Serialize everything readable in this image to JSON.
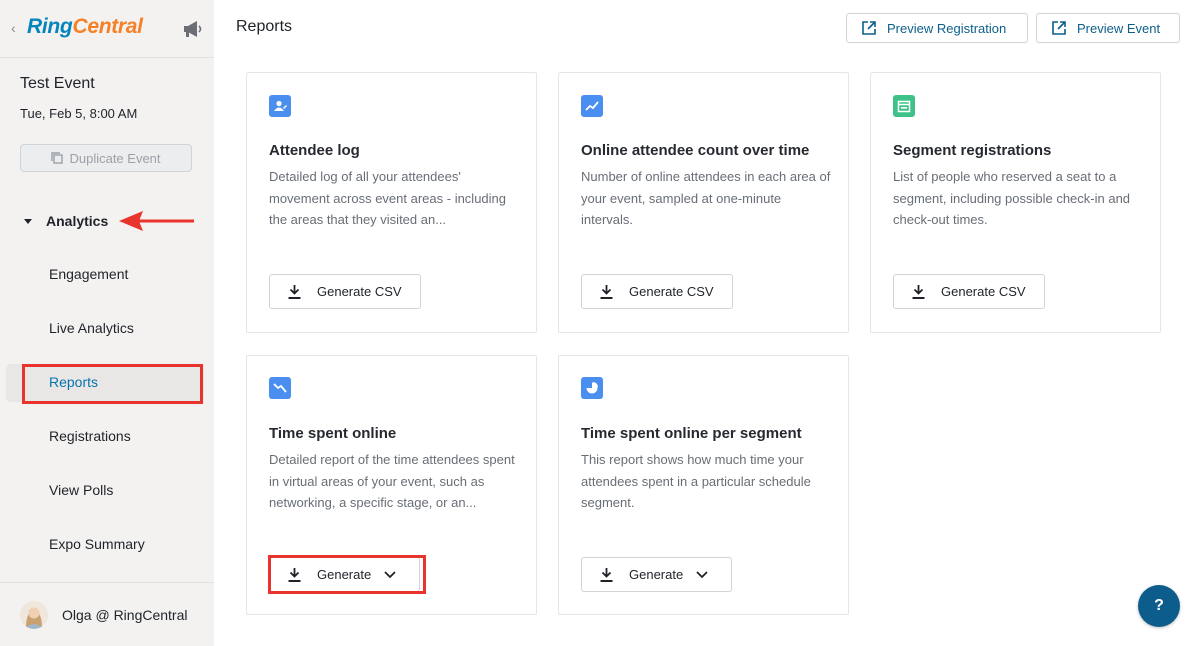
{
  "logo": {
    "ring": "Ring",
    "central": "Central"
  },
  "sidebar": {
    "event_title": "Test Event",
    "event_date": "Tue, Feb 5, 8:00 AM",
    "duplicate_label": "Duplicate Event",
    "section_label": "Analytics",
    "items": [
      {
        "label": "Engagement"
      },
      {
        "label": "Live Analytics"
      },
      {
        "label": "Reports",
        "active": true
      },
      {
        "label": "Registrations"
      },
      {
        "label": "View Polls"
      },
      {
        "label": "Expo Summary"
      }
    ],
    "user_name": "Olga @ RingCentral"
  },
  "header": {
    "title": "Reports",
    "preview_registration": "Preview Registration",
    "preview_event": "Preview Event"
  },
  "cards": [
    {
      "title": "Attendee log",
      "desc": "Detailed log of all your attendees' movement across event areas - including the areas that they visited an...",
      "button": "Generate CSV",
      "icon": "attendee-log-icon",
      "icon_color": "#4a8ef0"
    },
    {
      "title": "Online attendee count over time",
      "desc": "Number of online attendees in each area of your event, sampled at one-minute intervals.",
      "button": "Generate CSV",
      "icon": "trend-chart-icon",
      "icon_color": "#4a8ef0"
    },
    {
      "title": "Segment registrations",
      "desc": "List of people who reserved a seat to a segment, including possible check-in and check-out times.",
      "button": "Generate CSV",
      "icon": "calendar-icon",
      "icon_color": "#3fc28a"
    },
    {
      "title": "Time spent online",
      "desc": "Detailed report of the time attendees spent in virtual areas of your event, such as networking, a specific stage, or an...",
      "button": "Generate",
      "icon": "downtrend-chart-icon",
      "icon_color": "#4a8ef0"
    },
    {
      "title": "Time spent online per segment",
      "desc": "This report shows how much time your attendees spent in a particular schedule segment.",
      "button": "Generate",
      "icon": "pie-chart-icon",
      "icon_color": "#4a8ef0"
    }
  ],
  "help_label": "?",
  "colors": {
    "accent": "#0673ad",
    "highlight": "#e8342d",
    "help": "#0d5d8c"
  }
}
